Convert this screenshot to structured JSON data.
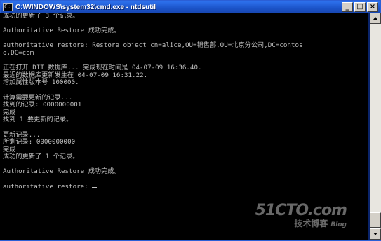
{
  "window": {
    "title": "C:\\WINDOWS\\system32\\cmd.exe - ntdsutil",
    "icon": "console-icon",
    "buttons": {
      "minimize": "_",
      "maximize": "□",
      "close": "×"
    }
  },
  "console": {
    "lines": [
      "成功的更新了 3 个记录。",
      "",
      "Authoritative Restore 成功完成。",
      "",
      "authoritative restore: Restore object cn=alice,OU=销售部,OU=北京分公司,DC=contos",
      "o,DC=com",
      "",
      "正在打开 DIT 数据库... 完成现在时间是 04-07-09 16:36.40.",
      "最近的数据库更新发生在 04-07-09 16:31.22.",
      "增加属性版本号 100000.",
      "",
      "计算需要更新的记录...",
      "找到的记录: 0000000001",
      "完成",
      "找到 1 要更新的记录。",
      "",
      "更新记录...",
      "所剩记录: 0000000000",
      "完成",
      "成功的更新了 1 个记录。",
      "",
      "Authoritative Restore 成功完成。",
      "",
      "authoritative restore: "
    ]
  },
  "watermark": {
    "logo": "51CTO.com",
    "sub": "技术博客",
    "blog": "Blog"
  },
  "colors": {
    "console_bg": "#000000",
    "console_fg": "#c0c0c0",
    "title_bar": "#1b53c8"
  }
}
